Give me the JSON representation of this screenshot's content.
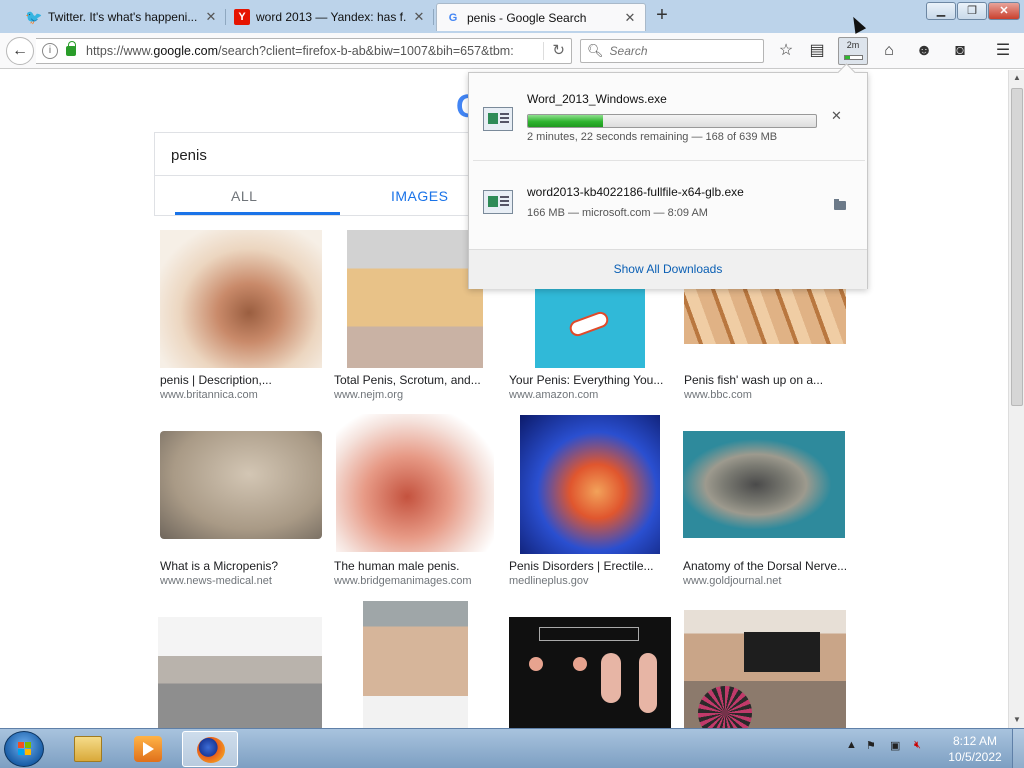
{
  "tabs": [
    {
      "title": "Twitter. It's what's happeni...",
      "favicon": "twitter-bird",
      "color": "#1da1f2"
    },
    {
      "title": "word 2013 — Yandex: has f...",
      "favicon": "Y",
      "color": "#e61400"
    },
    {
      "title": "penis - Google Search",
      "favicon": "G",
      "color": "#4285f4"
    }
  ],
  "navbar": {
    "url_prefix": "https://www.",
    "url_host": "google.com",
    "url_rest": "/search?client=firefox-b-ab&biw=1007&bih=657&tbm:",
    "search_placeholder": "Search",
    "download_badge": "2m"
  },
  "search": {
    "query": "penis",
    "tab_all": "ALL",
    "tab_images": "IMAGES"
  },
  "results": [
    {
      "caption": "penis | Description,...",
      "source": "www.britannica.com",
      "tone": "#e8c9b0"
    },
    {
      "caption": "Total Penis, Scrotum, and...",
      "source": "www.nejm.org",
      "tone": "#d9a45a"
    },
    {
      "caption": "Your Penis: Everything You...",
      "source": "www.amazon.com",
      "tone": "#30b9d8"
    },
    {
      "caption": "Penis fish' wash up on a...",
      "source": "www.bbc.com",
      "tone": "#c9905a"
    },
    {
      "caption": "What is a Micropenis?",
      "source": "www.news-medical.net",
      "tone": "#b9a793"
    },
    {
      "caption": "The human male penis.",
      "source": "www.bridgemanimages.com",
      "tone": "#d98575"
    },
    {
      "caption": "Penis Disorders | Erectile...",
      "source": "medlineplus.gov",
      "tone": "#2a4fd0"
    },
    {
      "caption": "Anatomy of the Dorsal Nerve...",
      "source": "www.goldjournal.net",
      "tone": "#2e8a9c"
    },
    {
      "caption": "",
      "source": "",
      "tone": "#c8c8c8"
    },
    {
      "caption": "",
      "source": "",
      "tone": "#8c8c8c"
    },
    {
      "caption": "",
      "source": "",
      "tone": "#101010"
    },
    {
      "caption": "",
      "source": "",
      "tone": "#c9a588"
    }
  ],
  "downloads": {
    "items": [
      {
        "name": "Word_2013_Windows.exe",
        "status": "2 minutes, 22 seconds remaining — 168 of 639 MB",
        "progress": 0.26
      },
      {
        "name": "word2013-kb4022186-fullfile-x64-glb.exe",
        "status": "166 MB — microsoft.com — 8:09 AM"
      }
    ],
    "show_all": "Show All Downloads"
  },
  "taskbar": {
    "time": "8:12 AM",
    "date": "10/5/2022"
  }
}
